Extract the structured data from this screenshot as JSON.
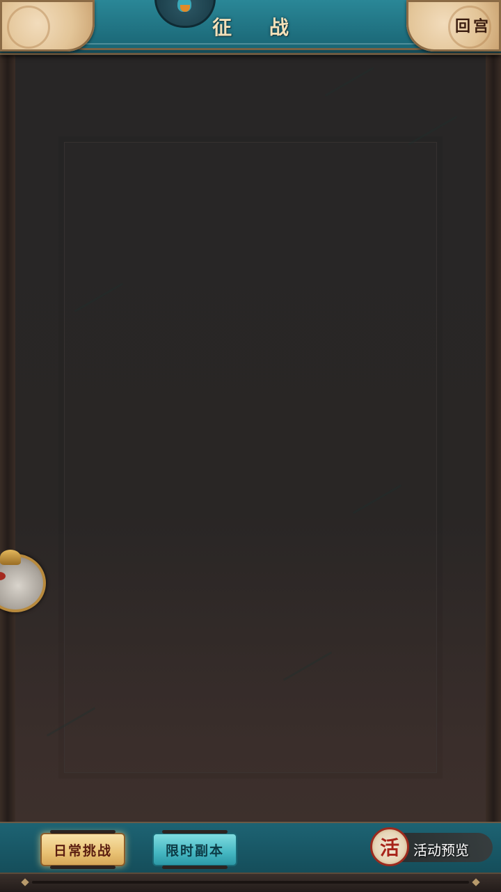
{
  "header": {
    "title": "征 战",
    "back_label": "回宫"
  },
  "tabs": [
    {
      "label": "日常挑战",
      "active": true
    },
    {
      "label": "限时副本",
      "active": false
    }
  ],
  "event_preview": {
    "seal_char": "活",
    "label": "活动预览"
  },
  "colors": {
    "teal_bar": "#1b5e6d",
    "gold_tab": "#e9c274",
    "cyan_tab": "#45b7c2",
    "panel_bg": "#282626"
  }
}
